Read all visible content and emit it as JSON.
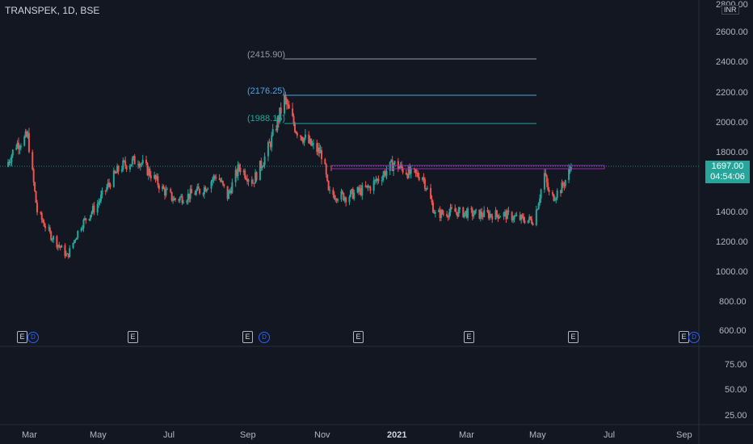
{
  "header": {
    "title": "TRANSPEK, 1D, BSE"
  },
  "price_scale": {
    "currency": "INR",
    "ticks": [
      "2800.00",
      "2600.00",
      "2400.00",
      "2200.00",
      "2000.00",
      "1800.00",
      "1400.00",
      "1200.00",
      "1000.00",
      "800.00",
      "600.00"
    ],
    "current_price": "1697.00",
    "countdown": "04:54:06"
  },
  "indicator_scale": {
    "ticks": [
      "75.00",
      "50.00",
      "25.00"
    ]
  },
  "time_axis": {
    "labels": [
      "Mar",
      "May",
      "Jul",
      "Sep",
      "Nov",
      "2021",
      "Mar",
      "May",
      "Jul",
      "Sep"
    ]
  },
  "fib_levels": [
    {
      "label": "(2415.90)",
      "color": "#9598a1"
    },
    {
      "label": "(2176.25)",
      "color": "#4fa3e0"
    },
    {
      "label": "(1988.15)",
      "color": "#26a69a"
    }
  ],
  "event_badges": [
    {
      "kind": "E",
      "dividend": true
    },
    {
      "kind": "E",
      "dividend": false
    },
    {
      "kind": "E",
      "dividend": true
    },
    {
      "kind": "E",
      "dividend": false
    },
    {
      "kind": "E",
      "dividend": false
    },
    {
      "kind": "E",
      "dividend": false
    },
    {
      "kind": "E",
      "dividend": true
    }
  ],
  "badge_dividend_letter": "D",
  "colors": {
    "up": "#26a69a",
    "down": "#ef5350",
    "background": "#131722",
    "resistance": "#9c27b0"
  },
  "chart_data": {
    "type": "candlestick",
    "title": "TRANSPEK, 1D, BSE",
    "ylim": [
      600,
      2800
    ],
    "series": [
      {
        "name": "TRANSPEK",
        "close_path": [
          [
            "2020-02-01",
            1700
          ],
          [
            "2020-02-10",
            1850
          ],
          [
            "2020-02-20",
            1900
          ],
          [
            "2020-02-28",
            1400
          ],
          [
            "2020-03-10",
            1250
          ],
          [
            "2020-03-20",
            1150
          ],
          [
            "2020-03-25",
            1100
          ],
          [
            "2020-04-05",
            1300
          ],
          [
            "2020-04-20",
            1450
          ],
          [
            "2020-05-01",
            1600
          ],
          [
            "2020-05-10",
            1700
          ],
          [
            "2020-05-25",
            1750
          ],
          [
            "2020-06-05",
            1650
          ],
          [
            "2020-06-15",
            1550
          ],
          [
            "2020-06-25",
            1480
          ],
          [
            "2020-07-05",
            1500
          ],
          [
            "2020-07-20",
            1550
          ],
          [
            "2020-08-01",
            1650
          ],
          [
            "2020-08-10",
            1500
          ],
          [
            "2020-08-20",
            1700
          ],
          [
            "2020-09-01",
            1600
          ],
          [
            "2020-09-12",
            1780
          ],
          [
            "2020-09-20",
            1950
          ],
          [
            "2020-09-28",
            2150
          ],
          [
            "2020-10-08",
            1950
          ],
          [
            "2020-10-20",
            1850
          ],
          [
            "2020-10-31",
            1780
          ],
          [
            "2020-11-05",
            1520
          ],
          [
            "2020-11-20",
            1500
          ],
          [
            "2020-12-10",
            1560
          ],
          [
            "2020-12-31",
            1720
          ],
          [
            "2021-01-15",
            1650
          ],
          [
            "2021-01-25",
            1640
          ],
          [
            "2021-02-05",
            1380
          ],
          [
            "2021-02-20",
            1400
          ],
          [
            "2021-03-15",
            1380
          ],
          [
            "2021-04-05",
            1380
          ],
          [
            "2021-04-20",
            1350
          ],
          [
            "2021-05-01",
            1340
          ],
          [
            "2021-05-10",
            1650
          ],
          [
            "2021-05-15",
            1480
          ],
          [
            "2021-05-25",
            1560
          ],
          [
            "2021-06-02",
            1697
          ]
        ],
        "last_close": 1697
      }
    ],
    "legend": "none",
    "grid": false
  }
}
